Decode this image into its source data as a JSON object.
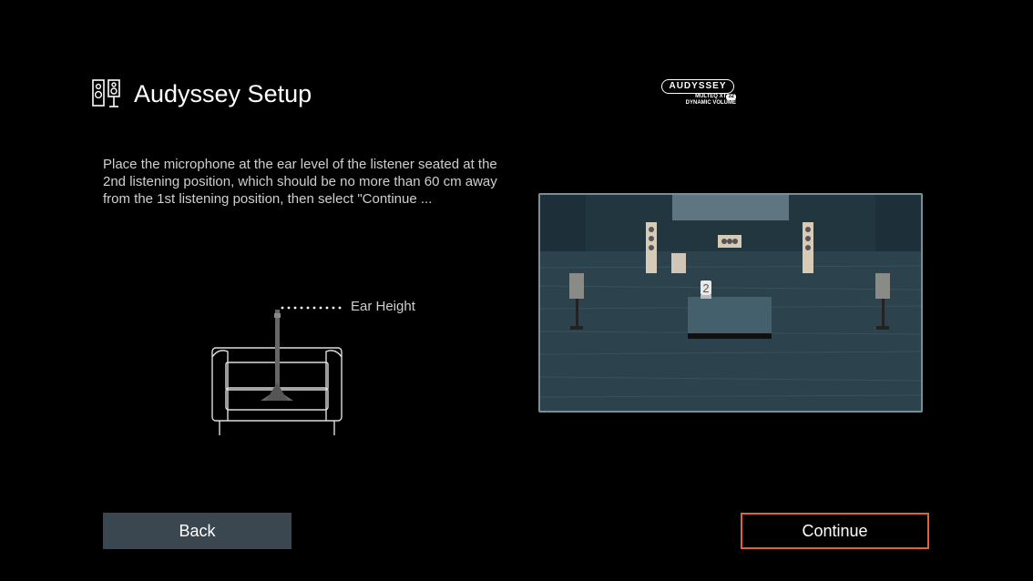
{
  "header": {
    "title": "Audyssey Setup",
    "icon": "speakers-icon"
  },
  "logo": {
    "brand": "AUDYSSEY",
    "line2": "MULTEQ XT",
    "line2_badge": "32",
    "line3": "DYNAMIC VOLUME"
  },
  "instructions": "Place the microphone at the ear level of the listener seated at the 2nd listening position, which should be no more than 60 cm away from the 1st listening position, then select \"Continue ...",
  "figure": {
    "ear_height_label": "Ear Height"
  },
  "room": {
    "position_marker": "2"
  },
  "buttons": {
    "back": "Back",
    "continue": "Continue"
  },
  "colors": {
    "background": "#000000",
    "back_button": "#3b4750",
    "continue_border": "#e0613f",
    "room_floor": "#2e4550"
  }
}
